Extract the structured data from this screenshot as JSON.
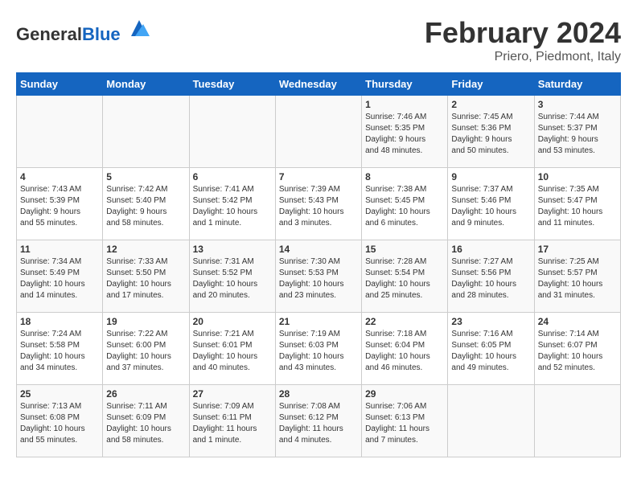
{
  "header": {
    "logo_general": "General",
    "logo_blue": "Blue",
    "month": "February 2024",
    "location": "Priero, Piedmont, Italy"
  },
  "days_of_week": [
    "Sunday",
    "Monday",
    "Tuesday",
    "Wednesday",
    "Thursday",
    "Friday",
    "Saturday"
  ],
  "weeks": [
    [
      {
        "day": "",
        "info": ""
      },
      {
        "day": "",
        "info": ""
      },
      {
        "day": "",
        "info": ""
      },
      {
        "day": "",
        "info": ""
      },
      {
        "day": "1",
        "info": "Sunrise: 7:46 AM\nSunset: 5:35 PM\nDaylight: 9 hours\nand 48 minutes."
      },
      {
        "day": "2",
        "info": "Sunrise: 7:45 AM\nSunset: 5:36 PM\nDaylight: 9 hours\nand 50 minutes."
      },
      {
        "day": "3",
        "info": "Sunrise: 7:44 AM\nSunset: 5:37 PM\nDaylight: 9 hours\nand 53 minutes."
      }
    ],
    [
      {
        "day": "4",
        "info": "Sunrise: 7:43 AM\nSunset: 5:39 PM\nDaylight: 9 hours\nand 55 minutes."
      },
      {
        "day": "5",
        "info": "Sunrise: 7:42 AM\nSunset: 5:40 PM\nDaylight: 9 hours\nand 58 minutes."
      },
      {
        "day": "6",
        "info": "Sunrise: 7:41 AM\nSunset: 5:42 PM\nDaylight: 10 hours\nand 1 minute."
      },
      {
        "day": "7",
        "info": "Sunrise: 7:39 AM\nSunset: 5:43 PM\nDaylight: 10 hours\nand 3 minutes."
      },
      {
        "day": "8",
        "info": "Sunrise: 7:38 AM\nSunset: 5:45 PM\nDaylight: 10 hours\nand 6 minutes."
      },
      {
        "day": "9",
        "info": "Sunrise: 7:37 AM\nSunset: 5:46 PM\nDaylight: 10 hours\nand 9 minutes."
      },
      {
        "day": "10",
        "info": "Sunrise: 7:35 AM\nSunset: 5:47 PM\nDaylight: 10 hours\nand 11 minutes."
      }
    ],
    [
      {
        "day": "11",
        "info": "Sunrise: 7:34 AM\nSunset: 5:49 PM\nDaylight: 10 hours\nand 14 minutes."
      },
      {
        "day": "12",
        "info": "Sunrise: 7:33 AM\nSunset: 5:50 PM\nDaylight: 10 hours\nand 17 minutes."
      },
      {
        "day": "13",
        "info": "Sunrise: 7:31 AM\nSunset: 5:52 PM\nDaylight: 10 hours\nand 20 minutes."
      },
      {
        "day": "14",
        "info": "Sunrise: 7:30 AM\nSunset: 5:53 PM\nDaylight: 10 hours\nand 23 minutes."
      },
      {
        "day": "15",
        "info": "Sunrise: 7:28 AM\nSunset: 5:54 PM\nDaylight: 10 hours\nand 25 minutes."
      },
      {
        "day": "16",
        "info": "Sunrise: 7:27 AM\nSunset: 5:56 PM\nDaylight: 10 hours\nand 28 minutes."
      },
      {
        "day": "17",
        "info": "Sunrise: 7:25 AM\nSunset: 5:57 PM\nDaylight: 10 hours\nand 31 minutes."
      }
    ],
    [
      {
        "day": "18",
        "info": "Sunrise: 7:24 AM\nSunset: 5:58 PM\nDaylight: 10 hours\nand 34 minutes."
      },
      {
        "day": "19",
        "info": "Sunrise: 7:22 AM\nSunset: 6:00 PM\nDaylight: 10 hours\nand 37 minutes."
      },
      {
        "day": "20",
        "info": "Sunrise: 7:21 AM\nSunset: 6:01 PM\nDaylight: 10 hours\nand 40 minutes."
      },
      {
        "day": "21",
        "info": "Sunrise: 7:19 AM\nSunset: 6:03 PM\nDaylight: 10 hours\nand 43 minutes."
      },
      {
        "day": "22",
        "info": "Sunrise: 7:18 AM\nSunset: 6:04 PM\nDaylight: 10 hours\nand 46 minutes."
      },
      {
        "day": "23",
        "info": "Sunrise: 7:16 AM\nSunset: 6:05 PM\nDaylight: 10 hours\nand 49 minutes."
      },
      {
        "day": "24",
        "info": "Sunrise: 7:14 AM\nSunset: 6:07 PM\nDaylight: 10 hours\nand 52 minutes."
      }
    ],
    [
      {
        "day": "25",
        "info": "Sunrise: 7:13 AM\nSunset: 6:08 PM\nDaylight: 10 hours\nand 55 minutes."
      },
      {
        "day": "26",
        "info": "Sunrise: 7:11 AM\nSunset: 6:09 PM\nDaylight: 10 hours\nand 58 minutes."
      },
      {
        "day": "27",
        "info": "Sunrise: 7:09 AM\nSunset: 6:11 PM\nDaylight: 11 hours\nand 1 minute."
      },
      {
        "day": "28",
        "info": "Sunrise: 7:08 AM\nSunset: 6:12 PM\nDaylight: 11 hours\nand 4 minutes."
      },
      {
        "day": "29",
        "info": "Sunrise: 7:06 AM\nSunset: 6:13 PM\nDaylight: 11 hours\nand 7 minutes."
      },
      {
        "day": "",
        "info": ""
      },
      {
        "day": "",
        "info": ""
      }
    ]
  ]
}
